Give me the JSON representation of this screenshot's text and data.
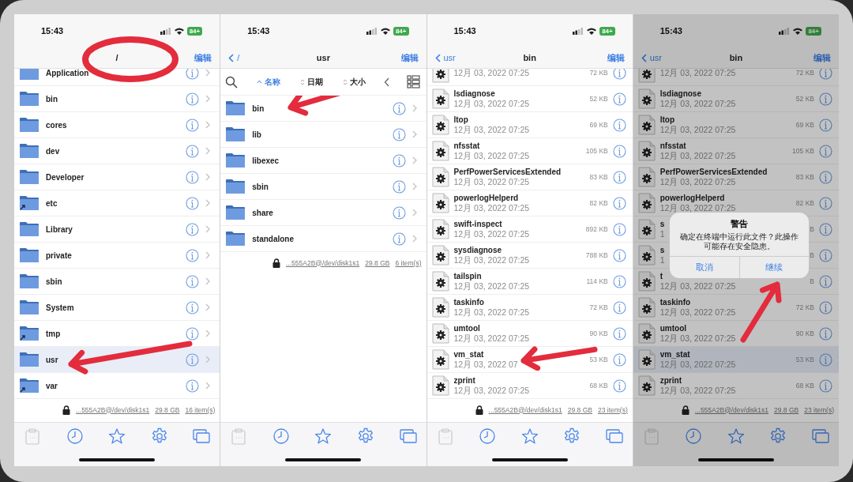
{
  "tab_bar": [
    {
      "kind": "clipboard",
      "disabled": true
    },
    {
      "kind": "clock",
      "disabled": false
    },
    {
      "kind": "star",
      "disabled": false
    },
    {
      "kind": "gear",
      "disabled": false
    },
    {
      "kind": "windows",
      "disabled": false
    }
  ],
  "panels": [
    {
      "status": {
        "time": "15:43",
        "battery": "84+"
      },
      "nav": {
        "title": "/",
        "edit": "编辑",
        "circled": true
      },
      "rows": [
        {
          "kind": "folder",
          "name": "Application",
          "link": false,
          "selected": false
        },
        {
          "kind": "folder",
          "name": "bin",
          "link": false,
          "selected": false
        },
        {
          "kind": "folder",
          "name": "cores",
          "link": false,
          "selected": false
        },
        {
          "kind": "folder",
          "name": "dev",
          "link": false,
          "selected": false
        },
        {
          "kind": "folder",
          "name": "Developer",
          "link": false,
          "selected": false
        },
        {
          "kind": "folder",
          "name": "etc",
          "link": true,
          "selected": false
        },
        {
          "kind": "folder",
          "name": "Library",
          "link": false,
          "selected": false
        },
        {
          "kind": "folder",
          "name": "private",
          "link": false,
          "selected": false
        },
        {
          "kind": "folder",
          "name": "sbin",
          "link": false,
          "selected": false
        },
        {
          "kind": "folder",
          "name": "System",
          "link": false,
          "selected": false
        },
        {
          "kind": "folder",
          "name": "tmp",
          "link": true,
          "selected": false
        },
        {
          "kind": "folder",
          "name": "usr",
          "link": false,
          "selected": true,
          "arrow": true
        },
        {
          "kind": "folder",
          "name": "var",
          "link": true,
          "selected": false
        }
      ],
      "footer": {
        "path": "...555A2B@/dev/disk1s1",
        "size": "29.8 GB",
        "count": "16 item(s)"
      }
    },
    {
      "status": {
        "time": "15:43",
        "battery": "84+"
      },
      "nav": {
        "back": "/",
        "title": "usr",
        "edit": "编辑"
      },
      "sort": [
        {
          "label": "名称",
          "selected": true
        },
        {
          "label": "日期",
          "selected": false
        },
        {
          "label": "大小",
          "selected": false
        }
      ],
      "rows": [
        {
          "kind": "folder",
          "name": "bin",
          "link": false,
          "selected": false,
          "arrow": true
        },
        {
          "kind": "folder",
          "name": "lib",
          "link": false,
          "selected": false
        },
        {
          "kind": "folder",
          "name": "libexec",
          "link": false,
          "selected": false
        },
        {
          "kind": "folder",
          "name": "sbin",
          "link": false,
          "selected": false
        },
        {
          "kind": "folder",
          "name": "share",
          "link": false,
          "selected": false
        },
        {
          "kind": "folder",
          "name": "standalone",
          "link": false,
          "selected": false
        }
      ],
      "footer": {
        "path": "...555A2B@/dev/disk1s1",
        "size": "29.8 GB",
        "count": "6 item(s)"
      }
    },
    {
      "status": {
        "time": "15:43",
        "battery": "84+"
      },
      "nav": {
        "back": "usr",
        "title": "bin",
        "edit": "编辑"
      },
      "rows": [
        {
          "kind": "file",
          "date": "12月 03, 2022 07:25",
          "size": "72 KB",
          "selected": false
        },
        {
          "kind": "file",
          "name": "lsdiagnose",
          "date": "12月 03, 2022 07:25",
          "size": "52 KB",
          "selected": false
        },
        {
          "kind": "file",
          "name": "ltop",
          "date": "12月 03, 2022 07:25",
          "size": "69 KB",
          "selected": false
        },
        {
          "kind": "file",
          "name": "nfsstat",
          "date": "12月 03, 2022 07:25",
          "size": "105 KB",
          "selected": false
        },
        {
          "kind": "file",
          "name": "PerfPowerServicesExtended",
          "date": "12月 03, 2022 07:25",
          "size": "83 KB",
          "selected": false
        },
        {
          "kind": "file",
          "name": "powerlogHelperd",
          "date": "12月 03, 2022 07:25",
          "size": "82 KB",
          "selected": false
        },
        {
          "kind": "file",
          "name": "swift-inspect",
          "date": "12月 03, 2022 07:25",
          "size": "892 KB",
          "selected": false
        },
        {
          "kind": "file",
          "name": "sysdiagnose",
          "date": "12月 03, 2022 07:25",
          "size": "788 KB",
          "selected": false
        },
        {
          "kind": "file",
          "name": "tailspin",
          "date": "12月 03, 2022 07:25",
          "size": "114 KB",
          "selected": false
        },
        {
          "kind": "file",
          "name": "taskinfo",
          "date": "12月 03, 2022 07:25",
          "size": "72 KB",
          "selected": false
        },
        {
          "kind": "file",
          "name": "umtool",
          "date": "12月 03, 2022 07:25",
          "size": "90 KB",
          "selected": false
        },
        {
          "kind": "file",
          "name": "vm_stat",
          "date": "12月 03, 2022 07",
          "size": "53 KB",
          "selected": false,
          "arrow": true
        },
        {
          "kind": "file",
          "name": "zprint",
          "date": "12月 03, 2022 07:25",
          "size": "68 KB",
          "selected": false
        }
      ],
      "footer": {
        "path": "...555A2B@/dev/disk1s1",
        "size": "29.8 GB",
        "count": "23 item(s)"
      }
    },
    {
      "status": {
        "time": "15:43",
        "battery": "84+"
      },
      "nav": {
        "back": "usr",
        "title": "bin",
        "edit": "编辑"
      },
      "dimmed": true,
      "rows": [
        {
          "kind": "file",
          "date": "12月 03, 2022 07:25",
          "size": "72 KB",
          "selected": false
        },
        {
          "kind": "file",
          "name": "lsdiagnose",
          "date": "12月 03, 2022 07:25",
          "size": "52 KB",
          "selected": false
        },
        {
          "kind": "file",
          "name": "ltop",
          "date": "12月 03, 2022 07:25",
          "size": "69 KB",
          "selected": false
        },
        {
          "kind": "file",
          "name": "nfsstat",
          "date": "12月 03, 2022 07:25",
          "size": "105 KB",
          "selected": false
        },
        {
          "kind": "file",
          "name": "PerfPowerServicesExtended",
          "date": "12月 03, 2022 07:25",
          "size": "83 KB",
          "selected": false
        },
        {
          "kind": "file",
          "name": "powerlogHelperd",
          "date": "12月 03, 2022 07:25",
          "size": "82 KB",
          "selected": false
        },
        {
          "kind": "file",
          "name": "s",
          "date": "1",
          "size": "B",
          "selected": false
        },
        {
          "kind": "file",
          "name": "s",
          "date": "1",
          "size": "B",
          "selected": false
        },
        {
          "kind": "file",
          "name": "t",
          "date": "12月 03, 2022 07:25",
          "size": "B",
          "selected": false
        },
        {
          "kind": "file",
          "name": "taskinfo",
          "date": "12月 03, 2022 07:25",
          "size": "72 KB",
          "selected": false
        },
        {
          "kind": "file",
          "name": "umtool",
          "date": "12月 03, 2022 07:25",
          "size": "90 KB",
          "selected": false
        },
        {
          "kind": "file",
          "name": "vm_stat",
          "date": "12月 03, 2022 07:25",
          "size": "53 KB",
          "selected": true
        },
        {
          "kind": "file",
          "name": "zprint",
          "date": "12月 03, 2022 07:25",
          "size": "68 KB",
          "selected": false
        }
      ],
      "footer": {
        "path": "...555A2B@/dev/disk1s1",
        "size": "29.8 GB",
        "count": "23 item(s)"
      },
      "dialog": {
        "title": "警告",
        "message": "确定在终端中运行此文件？此操作可能存在安全隐患。",
        "buttons": [
          {
            "label": "取消"
          },
          {
            "label": "继续"
          }
        ],
        "arrow": true
      }
    }
  ]
}
